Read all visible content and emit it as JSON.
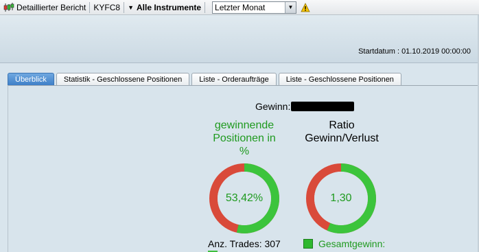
{
  "toolbar": {
    "report_label": "Detaillierter Bericht",
    "account": "KYFC8",
    "instruments_label": "Alle Instrumente",
    "period_select": {
      "value": "Letzter Monat"
    }
  },
  "header": {
    "startdatum": "Startdatum :  01.10.2019 00:00:00"
  },
  "tabs": [
    {
      "label": "Überblick",
      "active": true
    },
    {
      "label": "Statistik - Geschlossene Positionen"
    },
    {
      "label": "Liste - Orderaufträge"
    },
    {
      "label": "Liste - Geschlossene Positionen"
    }
  ],
  "overview": {
    "gewinn_label": "Gewinn:",
    "winning_positions": {
      "title_lines": [
        "gewinnende",
        "Positionen in",
        "%"
      ],
      "value_label": "53,42%",
      "value_fraction": 0.5342
    },
    "ratio": {
      "title_lines": [
        "Ratio",
        "Gewinn/Verlust"
      ],
      "value_label": "1,30",
      "green_fraction": 0.565
    },
    "anz_trades": "Anz. Trades: 307",
    "gesamtgewinn": "Gesamtgewinn:"
  },
  "colors": {
    "green": "#3cc43c",
    "red": "#d94a3a",
    "text_green": "#1f9a1f",
    "tab_active": "#4a8bd2"
  }
}
